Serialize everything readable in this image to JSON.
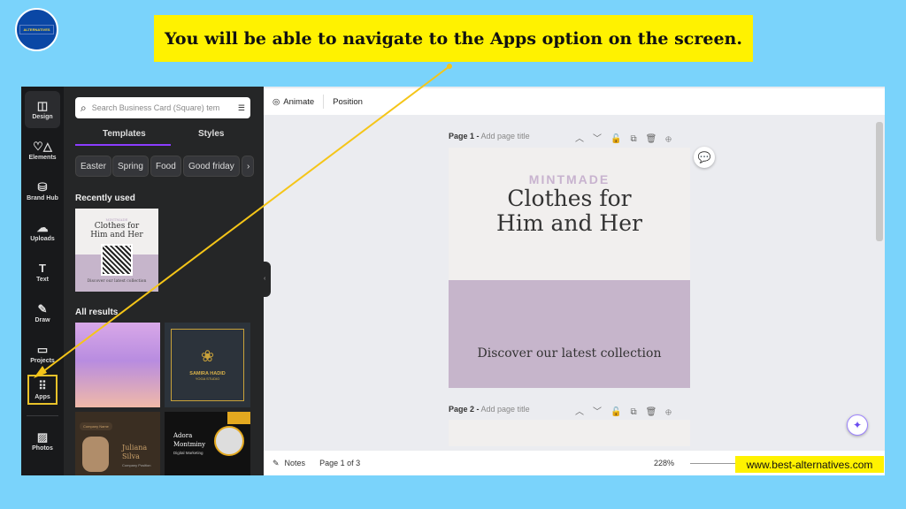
{
  "logo": {
    "text": "ALTERNATIVES"
  },
  "banner": "You will be able to navigate to the Apps option on the screen.",
  "footer_url": "www.best-alternatives.com",
  "rail": [
    {
      "label": "Design",
      "icon": "layout-icon",
      "glyph": "◫"
    },
    {
      "label": "Elements",
      "icon": "shapes-icon",
      "glyph": "♡△"
    },
    {
      "label": "Brand Hub",
      "icon": "brand-icon",
      "glyph": "⛁"
    },
    {
      "label": "Uploads",
      "icon": "cloud-upload-icon",
      "glyph": "☁"
    },
    {
      "label": "Text",
      "icon": "text-icon",
      "glyph": "T"
    },
    {
      "label": "Draw",
      "icon": "draw-icon",
      "glyph": "✎"
    },
    {
      "label": "Projects",
      "icon": "folder-icon",
      "glyph": "▭"
    },
    {
      "label": "Apps",
      "icon": "apps-grid-icon",
      "glyph": "⠿"
    },
    {
      "label": "Photos",
      "icon": "photo-icon",
      "glyph": "▨"
    }
  ],
  "panel": {
    "search_placeholder": "Search Business Card (Square) tem",
    "tabs": [
      "Templates",
      "Styles"
    ],
    "chips": [
      "Easter",
      "Spring",
      "Food",
      "Good friday"
    ],
    "recent_heading": "Recently used",
    "all_heading": "All results",
    "recent_card": {
      "brand": "MINTMADE",
      "title1": "Clothes for",
      "title2": "Him and Her",
      "footer": "Discover our latest collection"
    },
    "cards": [
      {
        "name": "SAMIRA HADID",
        "sub": "YOGA STUDIO"
      },
      {
        "name": "Juliana",
        "name2": "Silva",
        "sub": "Company Position",
        "tag": "Company Name"
      },
      {
        "name": "Adora",
        "name2": "Montminy",
        "sub": "Digital Marketing"
      }
    ]
  },
  "toolbar": {
    "animate": "Animate",
    "position": "Position"
  },
  "pages": [
    {
      "label": "Page 1 -",
      "title": "Add page title"
    },
    {
      "label": "Page 2 -",
      "title": "Add page title"
    }
  ],
  "design": {
    "brand": "MINTMADE",
    "line1": "Clothes for",
    "line2": "Him and Her",
    "tagline": "Discover our latest collection"
  },
  "bottom": {
    "notes": "Notes",
    "page_count": "Page 1 of 3",
    "zoom": "228%"
  },
  "colors": {
    "accent": "#8b3dff",
    "highlight": "#fff200",
    "arrow": "#f5c518",
    "design_top": "#f1efee",
    "design_bottom": "#c6b5cb"
  }
}
